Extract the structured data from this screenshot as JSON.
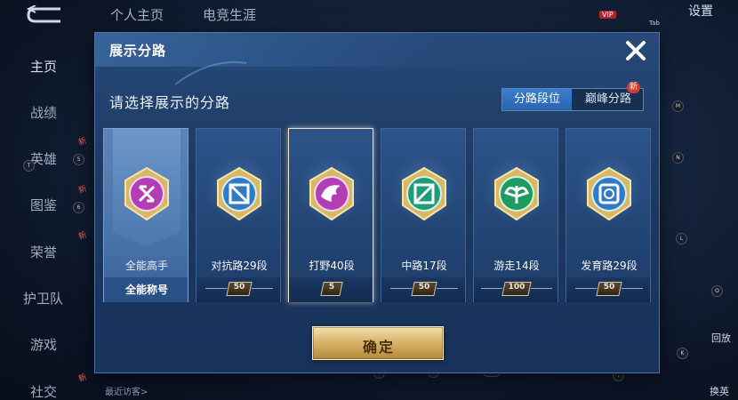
{
  "background": {
    "tabs": [
      "个人主页",
      "电竞生涯"
    ],
    "settings_label": "设置",
    "vip_label": "VIP",
    "tab_key": "Tab",
    "sidebar": [
      {
        "label": "主页",
        "active": true
      },
      {
        "label": "战绩",
        "active": false
      },
      {
        "label": "英雄",
        "active": false,
        "new": "新"
      },
      {
        "label": "图鉴",
        "active": false,
        "new": "新"
      },
      {
        "label": "荣誉",
        "active": false,
        "new": "新"
      },
      {
        "label": "护卫队",
        "active": false
      },
      {
        "label": "游戏",
        "active": false
      },
      {
        "label": "社交",
        "active": false,
        "new": "新"
      }
    ],
    "recent_visitors": "最近访客>",
    "right_labels": [
      "回放",
      "换英雄"
    ],
    "hotkeys": [
      "T",
      "5",
      "6",
      "W",
      "S",
      "D",
      "F",
      "C",
      "I",
      "2",
      "3",
      "M",
      "N",
      "L",
      "O",
      "K",
      "V",
      "E",
      "空格",
      "J",
      "."
    ]
  },
  "modal": {
    "title": "展示分路",
    "prompt": "请选择展示的分路",
    "toggle": {
      "options": [
        "分路段位",
        "巅峰分路"
      ],
      "selected": "分路段位",
      "new_badge": "新"
    },
    "confirm_label": "确定"
  },
  "lanes": [
    {
      "name": "全能高手",
      "rank": "",
      "subtitle": "全能称号",
      "color": "#b23db4",
      "icon": "allround-emblem-icon",
      "selected": false,
      "banner": true
    },
    {
      "name": "对抗路29段",
      "rank": "50",
      "color": "#2f7bc4",
      "icon": "clash-lane-emblem-icon",
      "selected": false
    },
    {
      "name": "打野40段",
      "rank": "5",
      "color": "#b23db4",
      "icon": "jungle-emblem-icon",
      "selected": true
    },
    {
      "name": "中路17段",
      "rank": "50",
      "color": "#1c9c78",
      "icon": "mid-lane-emblem-icon",
      "selected": false
    },
    {
      "name": "游走14段",
      "rank": "100",
      "color": "#1c9c5e",
      "icon": "roam-emblem-icon",
      "selected": false
    },
    {
      "name": "发育路29段",
      "rank": "50",
      "color": "#2f7bc4",
      "icon": "farm-lane-emblem-icon",
      "selected": false
    }
  ]
}
